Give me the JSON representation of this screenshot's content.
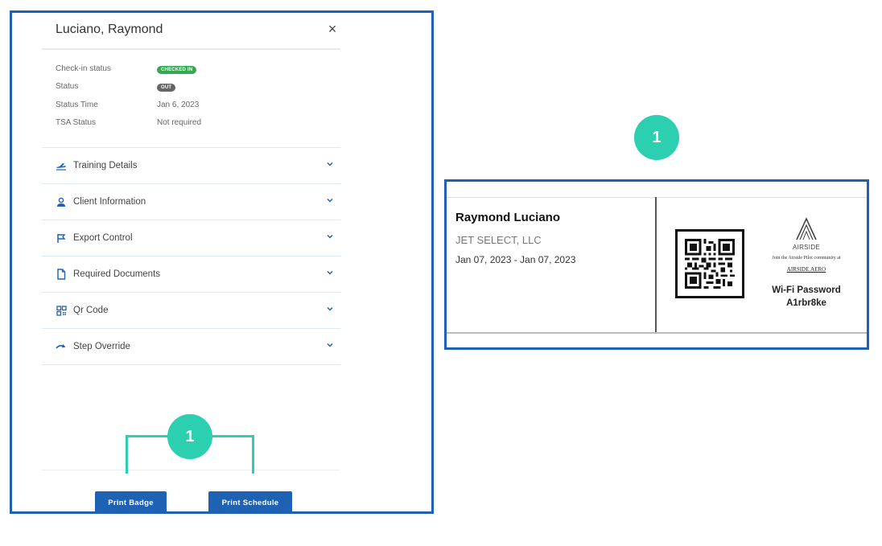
{
  "panel": {
    "name": "Luciano, Raymond",
    "close_symbol": "×",
    "info": [
      {
        "label": "Check-in status",
        "value": "CHECKED IN",
        "type": "pill",
        "color": "#34a853"
      },
      {
        "label": "Status",
        "value": "OUT",
        "type": "pill",
        "color": "#666666"
      },
      {
        "label": "Status Time",
        "value": "Jan 6, 2023",
        "type": "text"
      },
      {
        "label": "TSA Status",
        "value": "Not required",
        "type": "text"
      }
    ],
    "sections": [
      {
        "label": "Training Details",
        "icon": "airplane-icon"
      },
      {
        "label": "Client Information",
        "icon": "user-icon"
      },
      {
        "label": "Export Control",
        "icon": "flag-icon"
      },
      {
        "label": "Required Documents",
        "icon": "document-icon"
      },
      {
        "label": "Qr Code",
        "icon": "qr-code-icon"
      },
      {
        "label": "Step Override",
        "icon": "redo-arrow-icon"
      }
    ],
    "buttons": {
      "print_badge": "Print Badge",
      "print_schedule": "Print Schedule"
    }
  },
  "callouts": {
    "left": "1",
    "right": "1",
    "color": "#2ccfb0"
  },
  "badge": {
    "name": "Raymond Luciano",
    "company": "JET SELECT, LLC",
    "dates": "Jan 07, 2023 - Jan 07, 2023",
    "logo_text": "AIRSIDE",
    "join_text": "Join the Airside Pilot community at",
    "join_link": "AIRSIDE.AERO",
    "wifi_label": "Wi-Fi Password",
    "wifi_password": "A1rbr8ke"
  },
  "colors": {
    "accent": "#1f62b3",
    "callout": "#2ccfb0"
  }
}
